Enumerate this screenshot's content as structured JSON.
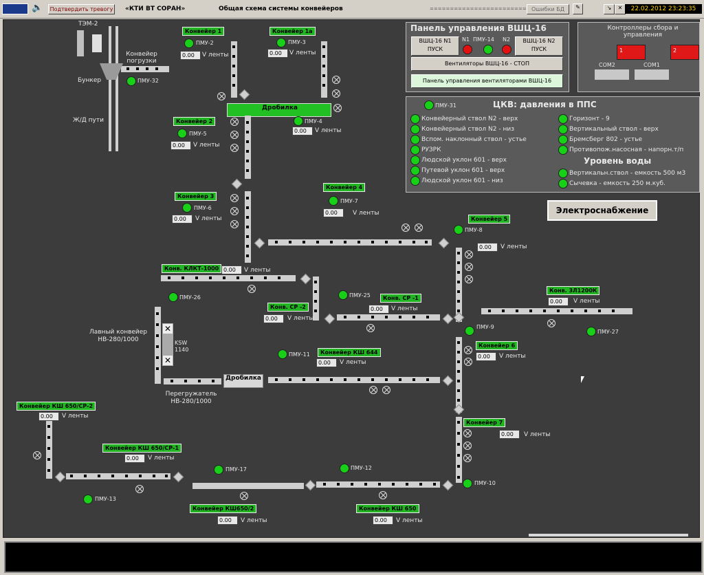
{
  "topbar": {
    "confirm_alarm": "Подтвердить тревогу",
    "company": "«КТИ ВТ СОРАН»",
    "title": "Общая схема системы конвейеров",
    "dashes": "==============================",
    "db_errors": "Ошибки БД",
    "datetime": "22.02.2012 23:23:35"
  },
  "legend": {
    "tem": "ТЭМ-2",
    "loading_conv": "Конвейер погрузки",
    "bunker": "Бункер",
    "rail": "Ж/Д пути",
    "crusher": "Дробилка",
    "crusher2": "Дробилка",
    "lava_conv": "Лавный конвейер НВ-280/1000",
    "ksw": "KSW 1140",
    "reloader": "Перегружатель НВ-280/1000",
    "v_unit": "V ленты"
  },
  "conveyors": [
    {
      "label": "Конвейер 1",
      "value": "0.00",
      "pmu": "ПМУ-2"
    },
    {
      "label": "Конвейер 1а",
      "value": "0.00",
      "pmu": "ПМУ-3"
    },
    {
      "label": "Конвейер 2",
      "value": "0.00",
      "pmu": "ПМУ-5"
    },
    {
      "label": "Конвейер 3",
      "value": "0.00",
      "pmu": "ПМУ-6"
    },
    {
      "label": "Конвейер 4",
      "value": "0.00",
      "pmu": "ПМУ-7"
    },
    {
      "label": "Конвейер 5",
      "value": "0.00",
      "pmu": "ПМУ-8"
    },
    {
      "label": "Конв. КЛКТ-1000",
      "value": "0.00"
    },
    {
      "label": "Конв. СР -2",
      "value": "0.00"
    },
    {
      "label": "Конв. СР -1",
      "value": "0.00"
    },
    {
      "label": "Конв. 3Л1200К",
      "value": "0.00"
    },
    {
      "label": "Конвейер КШ 644",
      "value": "0.00"
    },
    {
      "label": "Конвейер 6",
      "value": "0.00"
    },
    {
      "label": "Конвейер КШ 650/СР-2",
      "value": "0.00"
    },
    {
      "label": "Конвейер КШ 650/СР-1",
      "value": "0.00"
    },
    {
      "label": "Конвейер 7",
      "value": "0.00"
    },
    {
      "label": "Конвейер КШ650/2",
      "value": "0.00"
    },
    {
      "label": "Конвейер КШ 650",
      "value": "0.00"
    }
  ],
  "pmu": {
    "p32": "ПМУ-32",
    "p4": "ПМУ-4",
    "p26": "ПМУ-26",
    "p25": "ПМУ-25",
    "p9": "ПМУ-9",
    "p27": "ПМУ-27",
    "p11": "ПМУ-11",
    "p13": "ПМУ-13",
    "p17": "ПМУ-17",
    "p12": "ПМУ-12",
    "p10": "ПМУ-10"
  },
  "vshc": {
    "title": "Панель управления ВШЦ-16",
    "btn1": "ВШЦ-16 N1 ПУСК",
    "btn2": "ВШЦ-16 N2 ПУСК",
    "n1": "N1",
    "pmu14": "ПМУ-14",
    "n2": "N2",
    "fans": "Вентиляторы ВШЦ-16   -   СТОП",
    "fan_panel": "Панель управления вентиляторами ВШЦ-16"
  },
  "controllers": {
    "title": "Контроллеры сбора и управления",
    "c1": "1",
    "c2": "2",
    "com2": "COM2",
    "com1": "COM1"
  },
  "ckv": {
    "pmu31": "ПМУ-31",
    "title": "ЦКВ: давления в ППС",
    "left": [
      "Конвейерный ствол N2 - верх",
      "Конвейерный ствол N2 - низ",
      "Вспом. наклонный ствол - устье",
      "РУЗРК",
      "Людской уклон 601 - верх",
      "Путевой уклон 601 - верх",
      "Людской уклон 601 - низ"
    ],
    "right": [
      "Горизонт - 9",
      "Вертикальный ствол - верх",
      "Бремсберг 802 - устье",
      "Противопож.насосная - напорн.т/п"
    ],
    "water_title": "Уровень воды",
    "water": [
      "Вертикальн.ствол - емкость 500 м3",
      "Сычевка - емкость 250 м.куб."
    ]
  },
  "power_button": "Электроснабжение"
}
